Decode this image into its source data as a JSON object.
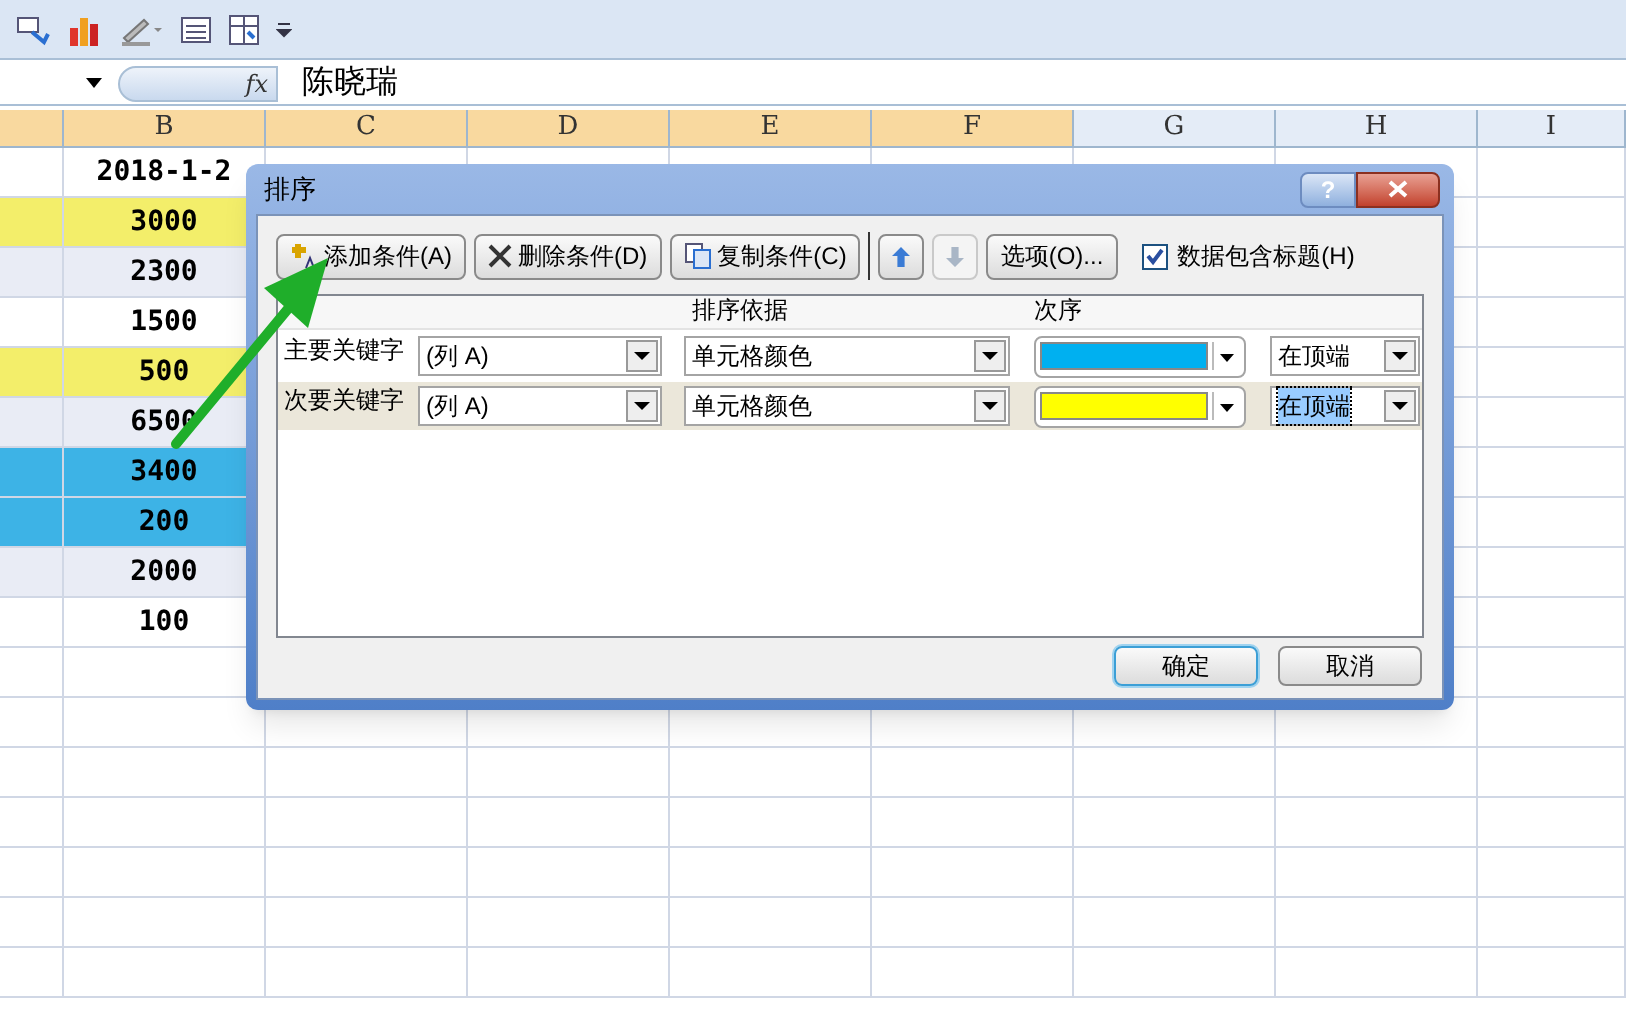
{
  "formula_bar": {
    "function_label": "fx",
    "value": "陈晓瑞"
  },
  "sheet": {
    "columns": [
      {
        "selected": true
      },
      {
        "label": "B",
        "selected": true
      },
      {
        "label": "C",
        "selected": true
      },
      {
        "label": "D",
        "selected": true
      },
      {
        "label": "E",
        "selected": true
      },
      {
        "label": "F",
        "selected": true
      },
      {
        "label": "G",
        "selected": false
      },
      {
        "label": "H",
        "selected": false
      },
      {
        "label": "I",
        "selected": false
      }
    ],
    "rows": [
      {
        "value": "2018-1-2",
        "color": "#ffffff"
      },
      {
        "value": "3000",
        "color": "#f3ee6a"
      },
      {
        "value": "2300",
        "color": "#e9ecf5"
      },
      {
        "value": "1500",
        "color": "#ffffff"
      },
      {
        "value": "500",
        "color": "#f3ee6a"
      },
      {
        "value": "6500",
        "color": "#e9ecf5"
      },
      {
        "value": "3400",
        "color": "#3db3e6"
      },
      {
        "value": "200",
        "color": "#3db3e6"
      },
      {
        "value": "2000",
        "color": "#e9ecf5"
      },
      {
        "value": "100",
        "color": "#ffffff"
      }
    ]
  },
  "dialog": {
    "title": "排序",
    "help": "?",
    "toolbar": [
      {
        "kind": "add",
        "label": "添加条件(A)",
        "disabled": false
      },
      {
        "kind": "delete",
        "label": "删除条件(D)",
        "disabled": false
      },
      {
        "kind": "copy",
        "label": "复制条件(C)",
        "disabled": false
      },
      {
        "kind": "up",
        "disabled": false
      },
      {
        "kind": "down",
        "disabled": true
      },
      {
        "kind": "options",
        "label": "选项(O)...",
        "disabled": false
      }
    ],
    "has_headers": {
      "label": "数据包含标题(H)",
      "checked": true
    },
    "headers": {
      "sort_on": "排序依据",
      "order": "次序"
    },
    "levels": [
      {
        "label": "主要关键字",
        "column": "(列 A)",
        "sort_on": "单元格颜色",
        "color": "#00b0f0",
        "position": "在顶端",
        "selected": false
      },
      {
        "label": "次要关键字",
        "column": "(列 A)",
        "sort_on": "单元格颜色",
        "color": "#ffff00",
        "position": "在顶端",
        "selected": true
      }
    ],
    "buttons": [
      {
        "label": "确定",
        "default": true
      },
      {
        "label": "取消",
        "default": false
      }
    ]
  }
}
